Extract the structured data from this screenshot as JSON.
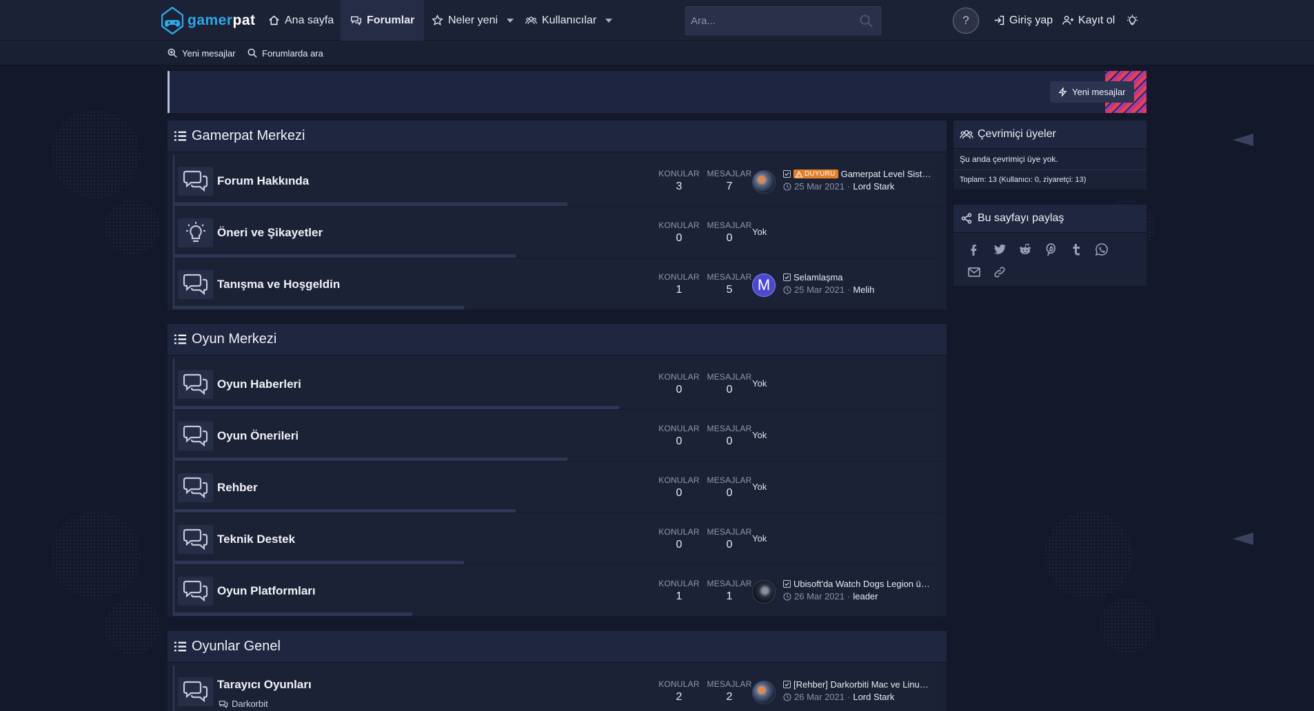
{
  "brand": {
    "name_part1": "gamer",
    "name_part2": "pat",
    "accent": "#30a7e8"
  },
  "nav": {
    "items": [
      {
        "label": "Ana sayfa",
        "icon": "home-icon"
      },
      {
        "label": "Forumlar",
        "icon": "comments-icon",
        "active": true
      },
      {
        "label": "Neler yeni",
        "icon": "star-icon",
        "dropdown": true
      },
      {
        "label": "Kullanıcılar",
        "icon": "users-icon",
        "dropdown": true
      }
    ],
    "search_placeholder": "Ara...",
    "help_label": "?",
    "login_label": "Giriş yap",
    "register_label": "Kayıt ol"
  },
  "subnav": {
    "new_posts": "Yeni mesajlar",
    "search_forums": "Forumlarda ara"
  },
  "notice": {
    "button_label": "Yeni mesajlar"
  },
  "labels": {
    "threads": "KONULAR",
    "messages": "MESAJLAR",
    "none": "Yok",
    "sep": "·"
  },
  "categories": [
    {
      "title": "Gamerpat Merkezi",
      "nodes": [
        {
          "title": "Forum Hakkında",
          "icon": "comments-icon",
          "threads": "3",
          "messages": "7",
          "last": {
            "badge": "DUYURU",
            "title": "Gamerpat Level Sistemi",
            "date": "25 Mar 2021",
            "user": "Lord Stark",
            "avatar": "img1"
          }
        },
        {
          "title": "Öneri ve Şikayetler",
          "icon": "lightbulb-icon",
          "threads": "0",
          "messages": "0",
          "last": null
        },
        {
          "title": "Tanışma ve Hoşgeldin",
          "icon": "comments-icon",
          "threads": "1",
          "messages": "5",
          "last": {
            "title": "Selamlaşma",
            "date": "25 Mar 2021",
            "user": "Melih",
            "avatar": "letter",
            "letter": "M"
          }
        }
      ]
    },
    {
      "title": "Oyun Merkezi",
      "nodes": [
        {
          "title": "Oyun Haberleri",
          "icon": "comments-icon",
          "threads": "0",
          "messages": "0",
          "last": null
        },
        {
          "title": "Oyun Önerileri",
          "icon": "comments-icon",
          "threads": "0",
          "messages": "0",
          "last": null
        },
        {
          "title": "Rehber",
          "icon": "comments-icon",
          "threads": "0",
          "messages": "0",
          "last": null
        },
        {
          "title": "Teknik Destek",
          "icon": "comments-icon",
          "threads": "0",
          "messages": "0",
          "last": null
        },
        {
          "title": "Oyun Platformları",
          "icon": "comments-icon",
          "threads": "1",
          "messages": "1",
          "last": {
            "title": "Ubisoft'da Watch Dogs Legion ücretsiz",
            "date": "26 Mar 2021",
            "user": "leader",
            "avatar": "img2"
          }
        }
      ]
    },
    {
      "title": "Oyunlar Genel",
      "nodes": [
        {
          "title": "Tarayıcı Oyunları",
          "icon": "comments-icon",
          "threads": "2",
          "messages": "2",
          "subforum": "Darkorbit",
          "last": {
            "title": "[Rehber] Darkorbiti Mac ve Linux'ta oynama",
            "date": "26 Mar 2021",
            "user": "Lord Stark",
            "avatar": "img1"
          }
        }
      ]
    }
  ],
  "sidebar": {
    "online": {
      "title": "Çevrimiçi üyeler",
      "empty": "Şu anda çevrimiçi üye yok.",
      "total": "Toplam: 13 (Kullanıcı: 0, ziyaretçi: 13)"
    },
    "share": {
      "title": "Bu sayfayı paylaş",
      "icons": [
        "facebook-icon",
        "twitter-icon",
        "reddit-icon",
        "pinterest-icon",
        "tumblr-icon",
        "whatsapp-icon",
        "email-icon",
        "link-icon"
      ]
    }
  }
}
